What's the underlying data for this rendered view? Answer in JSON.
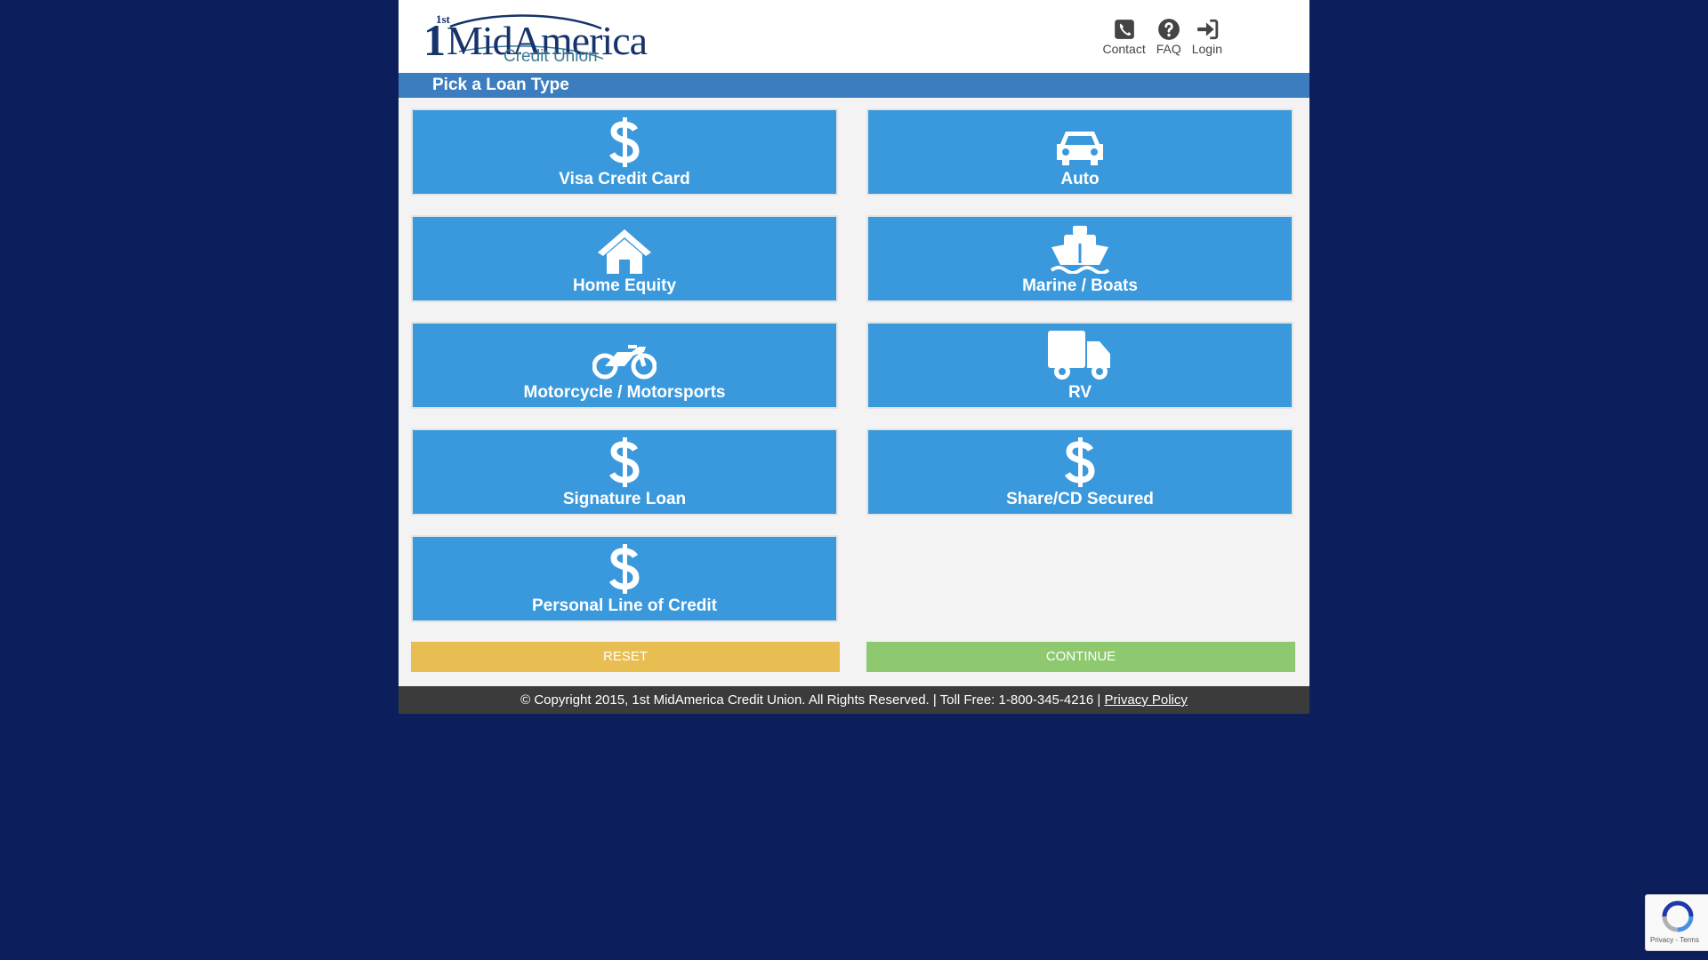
{
  "logo": {
    "prefix": "1st",
    "name": "MidAmerica",
    "subtitle": "Credit Union"
  },
  "top_nav": [
    {
      "label": "Contact",
      "icon": "phone-icon"
    },
    {
      "label": "FAQ",
      "icon": "question-circle-icon"
    },
    {
      "label": "Login",
      "icon": "sign-in-icon"
    }
  ],
  "section_title": "Pick a Loan Type",
  "loan_types": [
    {
      "label": "Visa Credit Card",
      "icon": "dollar-icon"
    },
    {
      "label": "Auto",
      "icon": "car-icon"
    },
    {
      "label": "Home Equity",
      "icon": "home-icon"
    },
    {
      "label": "Marine / Boats",
      "icon": "ship-icon"
    },
    {
      "label": "Motorcycle / Motorsports",
      "icon": "motorcycle-icon"
    },
    {
      "label": "RV",
      "icon": "truck-icon"
    },
    {
      "label": "Signature Loan",
      "icon": "dollar-icon"
    },
    {
      "label": "Share/CD Secured",
      "icon": "dollar-icon"
    },
    {
      "label": "Personal Line of Credit",
      "icon": "dollar-icon"
    }
  ],
  "actions": {
    "reset_label": "RESET",
    "continue_label": "CONTINUE"
  },
  "footer": {
    "text": "© Copyright 2015, 1st MidAmerica Credit Union. All Rights Reserved. | Toll Free: 1-800-345-4216 |",
    "privacy_link": "Privacy Policy"
  },
  "recaptcha": {
    "terms_text": "Privacy - Terms"
  },
  "colors": {
    "background": "#0c1f5c",
    "tile": "#3a99dd",
    "title_bar": "#3c7dc0",
    "reset": "#e8be52",
    "continue": "#8ec970",
    "footer": "#3b3b3b"
  }
}
